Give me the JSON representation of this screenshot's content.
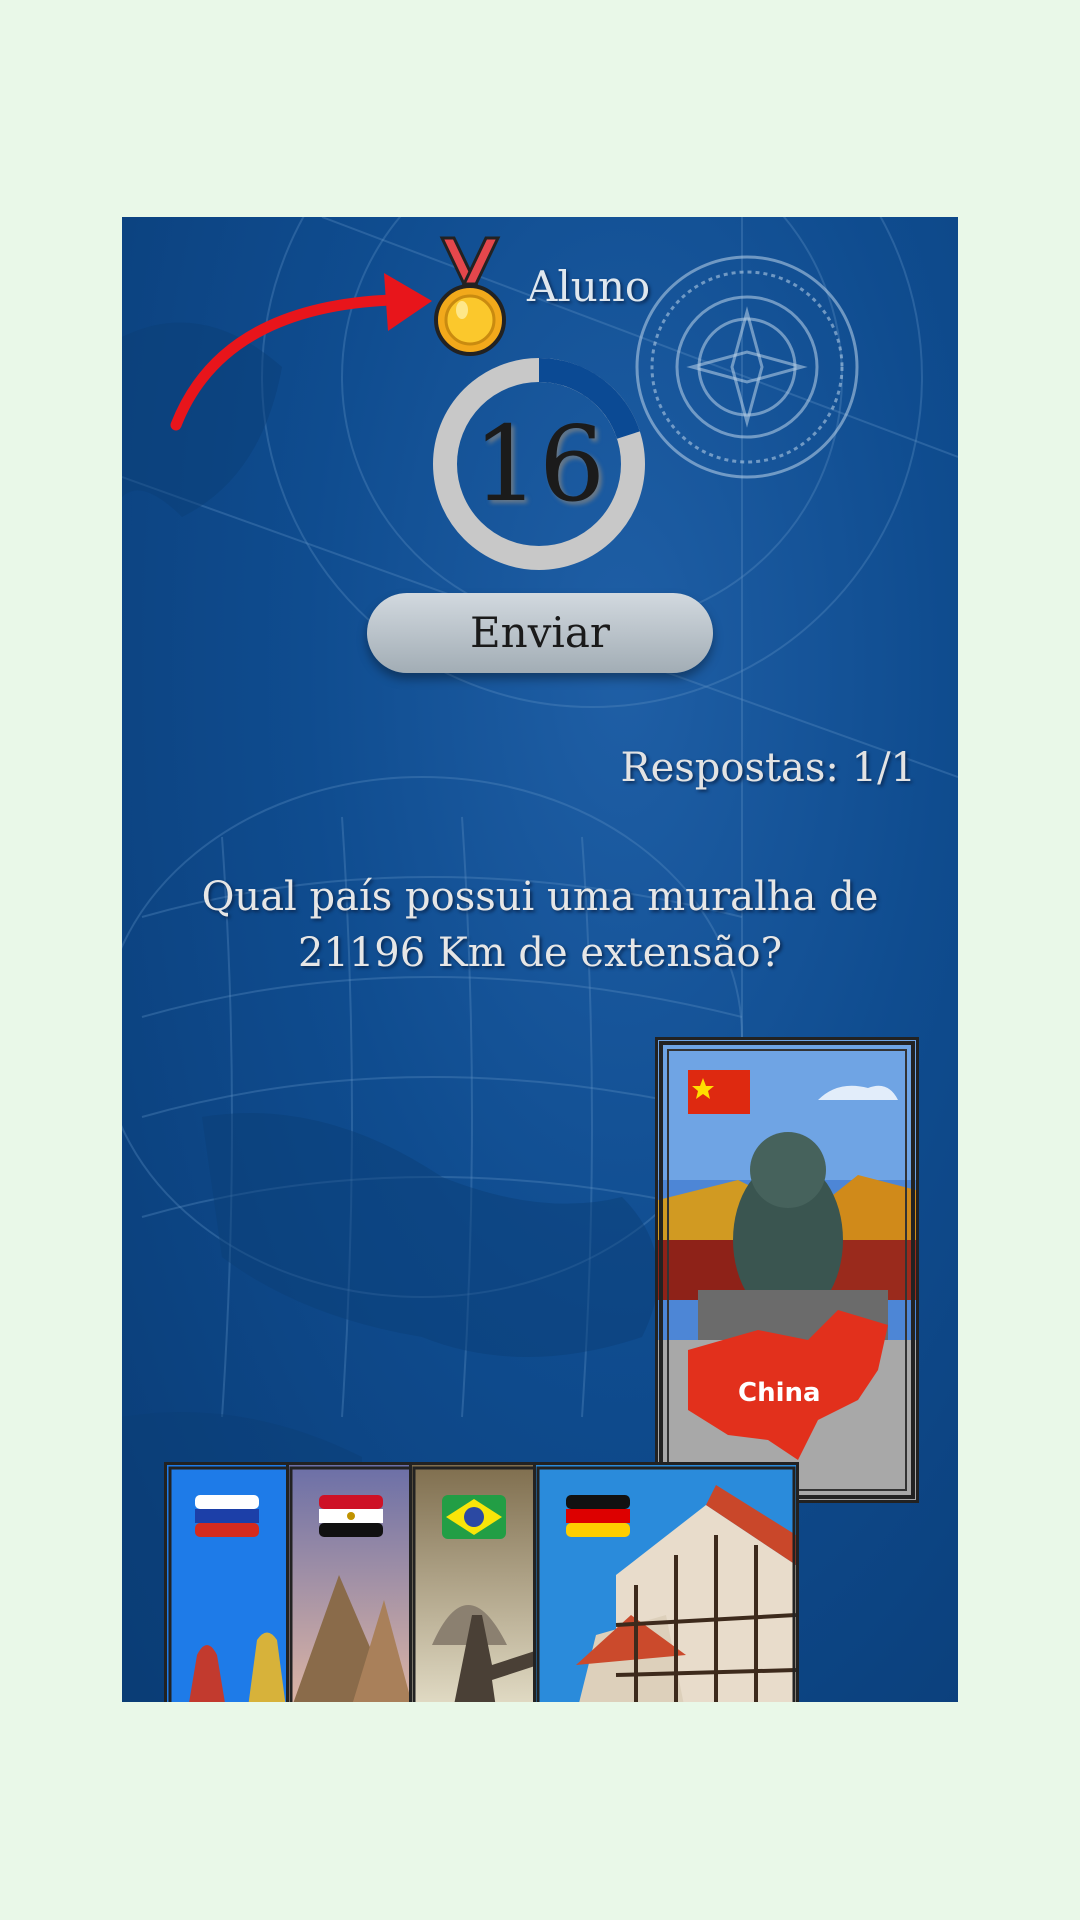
{
  "header": {
    "player_name": "Aluno",
    "timer_value": "16",
    "timer_progress": 0.2
  },
  "actions": {
    "send_label": "Enviar"
  },
  "status": {
    "answers_text": "Respostas: 1/1"
  },
  "question": {
    "text": "Qual país possui uma muralha de 21196 Km de extensão?"
  },
  "cards": {
    "selected": {
      "country": "China",
      "label": "China",
      "flag": "china-flag-icon"
    },
    "hand": [
      {
        "country": "Russia",
        "flag": "russia-flag-icon"
      },
      {
        "country": "Egypt",
        "flag": "egypt-flag-icon"
      },
      {
        "country": "Brazil",
        "flag": "brazil-flag-icon"
      },
      {
        "country": "Germany",
        "flag": "germany-flag-icon"
      }
    ]
  },
  "colors": {
    "background": "#e9f8e8",
    "board": "#0f4c8f",
    "arrow": "#e8151b",
    "timer_ring": "#c8c8c8",
    "timer_progress": "#0b4a94"
  }
}
